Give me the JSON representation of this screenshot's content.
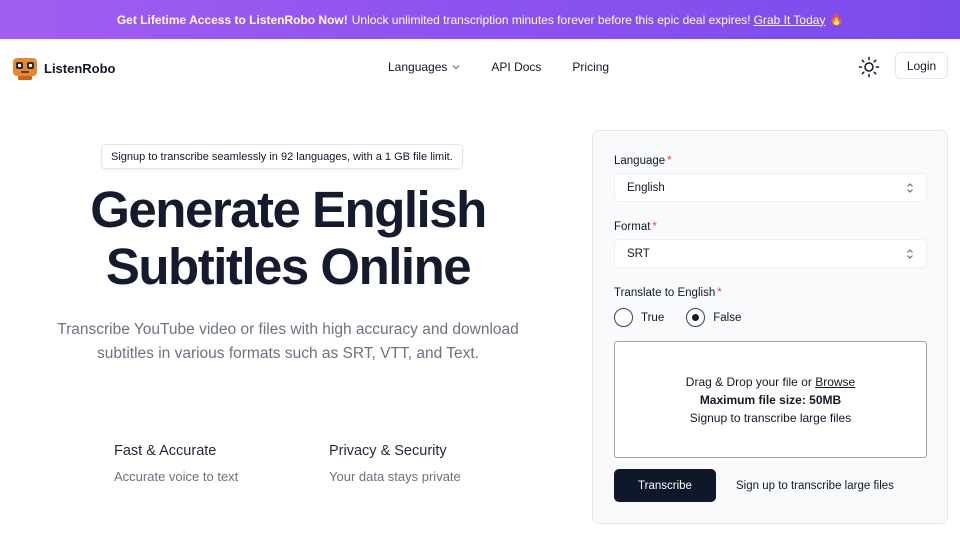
{
  "banner": {
    "bold": "Get Lifetime Access to ListenRobo Now!",
    "text": "Unlock unlimited transcription minutes forever before this epic deal expires!",
    "link": "Grab It Today",
    "emoji": "🔥"
  },
  "header": {
    "brand": "ListenRobo",
    "nav": [
      {
        "label": "Languages"
      },
      {
        "label": "API Docs"
      },
      {
        "label": "Pricing"
      }
    ],
    "login": "Login"
  },
  "hero": {
    "pill": "Signup to transcribe seamlessly in 92 languages, with a 1 GB file limit.",
    "title_line1": "Generate English",
    "title_line2": "Subtitles Online",
    "subtitle": "Transcribe YouTube video or files with high accuracy and download subtitles in various formats such as SRT, VTT, and Text.",
    "features": [
      {
        "title": "Fast & Accurate",
        "desc": "Accurate voice to text"
      },
      {
        "title": "Privacy & Security",
        "desc": "Your data stays private"
      }
    ]
  },
  "form": {
    "language_label": "Language",
    "language_value": "English",
    "format_label": "Format",
    "format_value": "SRT",
    "translate_label": "Translate to English",
    "required_mark": "*",
    "options": [
      {
        "label": "True",
        "checked": false
      },
      {
        "label": "False",
        "checked": true
      }
    ],
    "drop_text": "Drag & Drop your file or",
    "browse": "Browse",
    "max_size": "Maximum file size: 50MB",
    "signup_large": "Signup to transcribe large files",
    "transcribe_button": "Transcribe",
    "signup_link": "Sign up to transcribe large files"
  }
}
